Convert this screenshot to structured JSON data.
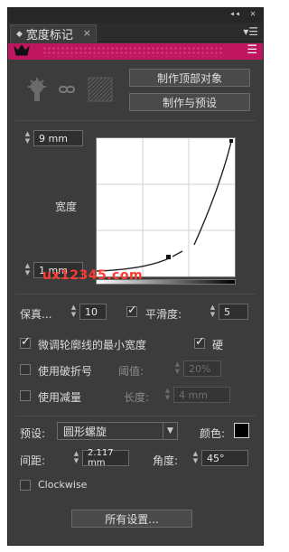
{
  "titlebar": {
    "collapse_glyph": "◂◂",
    "close_glyph": "✕"
  },
  "tab": {
    "icon": "◆",
    "title": "宽度标记",
    "close": "×",
    "menu_icon": "panel-menu-icon"
  },
  "brand": {
    "color": "#c0155f",
    "logo": "crown-icon",
    "menu_icon": "hamburger-icon"
  },
  "actions": {
    "make_top_object": "制作顶部对象",
    "make_and_preset": "制作与预设"
  },
  "icons": {
    "brush": "brush-tool-icon",
    "link": "link-icon",
    "pattern": "hatched-pattern-icon"
  },
  "width_profile": {
    "max_width": "9 mm",
    "min_width": "1 mm",
    "label": "宽度"
  },
  "controls": {
    "fidelity_label": "保真...",
    "fidelity_value": "10",
    "smooth_checked": true,
    "smooth_label": "平滑度:",
    "smooth_value": "5",
    "fine_tune_checked": true,
    "fine_tune_label": "微调轮廓线的最小宽度",
    "hard_checked": true,
    "hard_label": "硬",
    "break_checked": false,
    "break_label": "使用破折号",
    "threshold_label": "阈值:",
    "threshold_value": "20%",
    "taper_checked": false,
    "taper_label": "使用减量",
    "length_label": "长度:",
    "length_value": "4 mm"
  },
  "preset": {
    "label": "预设:",
    "value": "圆形螺旋",
    "color_label": "颜色:",
    "color": "#000000",
    "spacing_label": "间距:",
    "spacing_value": "2.117 mm",
    "angle_label": "角度:",
    "angle_value": "45°",
    "clockwise_checked": false,
    "clockwise_label": "Clockwise"
  },
  "all_settings": "所有设置...",
  "watermark": "ux12345.com"
}
